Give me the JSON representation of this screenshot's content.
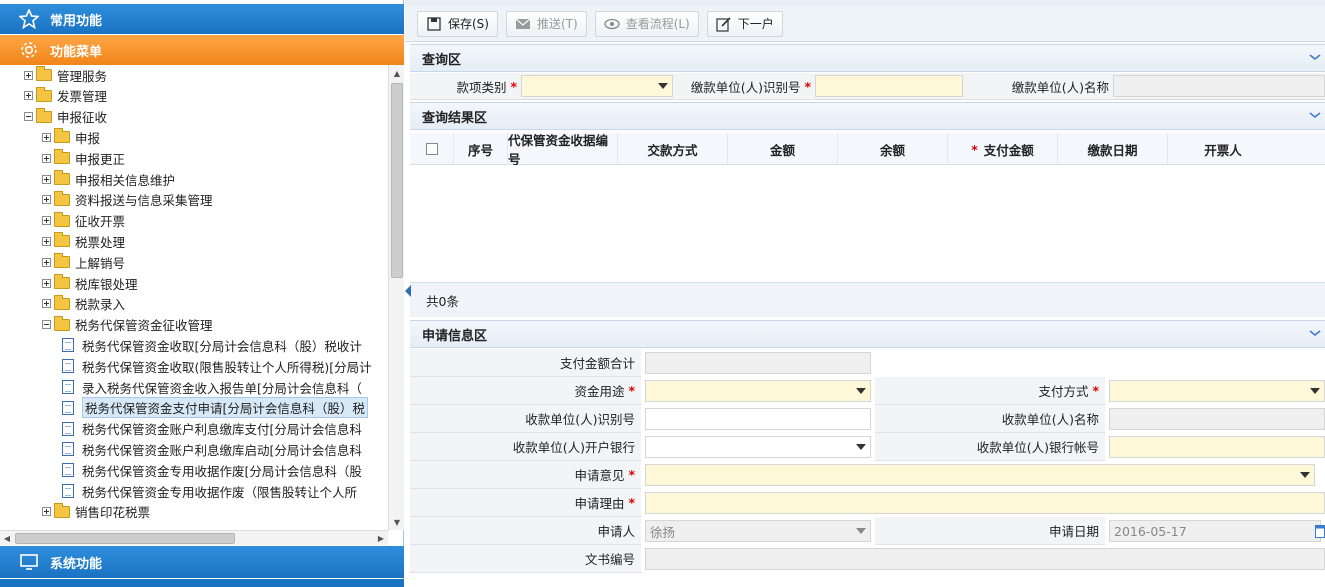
{
  "sidebar": {
    "common": "常用功能",
    "func_menu": "功能菜单",
    "system": "系统功能",
    "tree": [
      {
        "label": "管理服务",
        "level": 0,
        "type": "folder",
        "expand": "plus"
      },
      {
        "label": "发票管理",
        "level": 0,
        "type": "folder",
        "expand": "plus"
      },
      {
        "label": "申报征收",
        "level": 0,
        "type": "folder",
        "expand": "minus"
      },
      {
        "label": "申报",
        "level": 1,
        "type": "folder",
        "expand": "plus"
      },
      {
        "label": "申报更正",
        "level": 1,
        "type": "folder",
        "expand": "plus"
      },
      {
        "label": "申报相关信息维护",
        "level": 1,
        "type": "folder",
        "expand": "plus"
      },
      {
        "label": "资料报送与信息采集管理",
        "level": 1,
        "type": "folder",
        "expand": "plus"
      },
      {
        "label": "征收开票",
        "level": 1,
        "type": "folder",
        "expand": "plus"
      },
      {
        "label": "税票处理",
        "level": 1,
        "type": "folder",
        "expand": "plus"
      },
      {
        "label": "上解销号",
        "level": 1,
        "type": "folder",
        "expand": "plus"
      },
      {
        "label": "税库银处理",
        "level": 1,
        "type": "folder",
        "expand": "plus"
      },
      {
        "label": "税款录入",
        "level": 1,
        "type": "folder",
        "expand": "plus"
      },
      {
        "label": "税务代保管资金征收管理",
        "level": 1,
        "type": "folder",
        "expand": "minus"
      },
      {
        "label": "税务代保管资金收取[分局计会信息科（股）税收计",
        "level": 2,
        "type": "doc"
      },
      {
        "label": "税务代保管资金收取(限售股转让个人所得税)[分局计",
        "level": 2,
        "type": "doc"
      },
      {
        "label": "录入税务代保管资金收入报告单[分局计会信息科（",
        "level": 2,
        "type": "doc"
      },
      {
        "label": "税务代保管资金支付申请[分局计会信息科（股）税",
        "level": 2,
        "type": "doc",
        "selected": true
      },
      {
        "label": "税务代保管资金账户利息缴库支付[分局计会信息科",
        "level": 2,
        "type": "doc"
      },
      {
        "label": "税务代保管资金账户利息缴库启动[分局计会信息科",
        "level": 2,
        "type": "doc"
      },
      {
        "label": "税务代保管资金专用收据作废[分局计会信息科（股",
        "level": 2,
        "type": "doc"
      },
      {
        "label": "税务代保管资金专用收据作废（限售股转让个人所",
        "level": 2,
        "type": "doc"
      },
      {
        "label": "销售印花税票",
        "level": 1,
        "type": "folder",
        "expand": "plus"
      }
    ]
  },
  "toolbar": {
    "save": "保存(S)",
    "push": "推送(T)",
    "view_flow": "查看流程(L)",
    "next": "下一户"
  },
  "query": {
    "title": "查询区",
    "type_label": "款项类别",
    "id_label": "缴款单位(人)识别号",
    "name_label": "缴款单位(人)名称"
  },
  "result": {
    "title": "查询结果区",
    "columns": [
      "序号",
      "代保管资金收据编号",
      "交款方式",
      "金额",
      "余额",
      "支付金额",
      "缴款日期",
      "开票人"
    ],
    "required_col": "*",
    "count": "共0条"
  },
  "apply": {
    "title": "申请信息区",
    "total_label": "支付金额合计",
    "use_label": "资金用途",
    "pay_method_label": "支付方式",
    "payee_id_label": "收款单位(人)识别号",
    "payee_name_label": "收款单位(人)名称",
    "payee_bank_label": "收款单位(人)开户银行",
    "payee_account_label": "收款单位(人)银行帐号",
    "opinion_label": "申请意见",
    "reason_label": "申请理由",
    "applicant_label": "申请人",
    "applicant_value": "徐扬",
    "date_label": "申请日期",
    "date_value": "2016-05-17",
    "doc_no_label": "文书编号",
    "required_mark": "*"
  },
  "colors": {
    "sidebar_blue": "#1a72c2",
    "menu_orange": "#f08519",
    "required_red": "#dd0000",
    "field_yellow": "#fff8d8"
  }
}
